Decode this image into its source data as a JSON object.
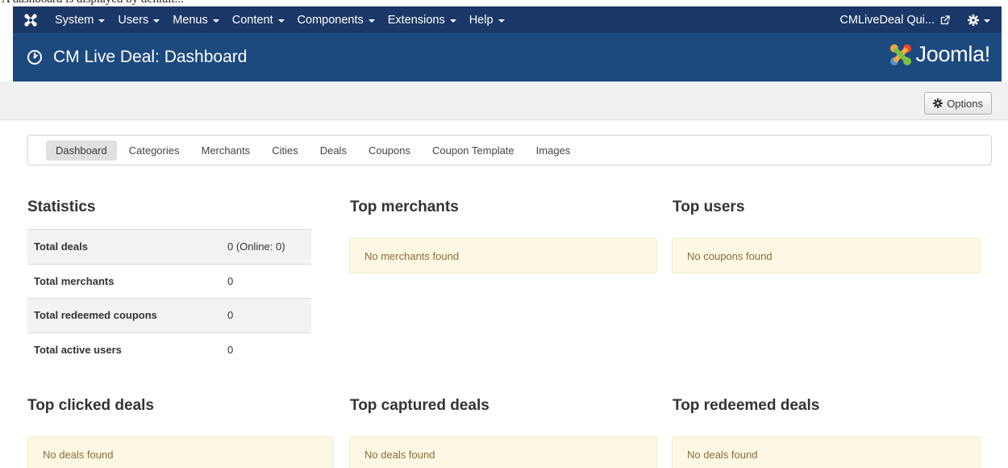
{
  "top_strip_text": "A dashboard is displayed by default...",
  "navbar": {
    "menus": [
      {
        "label": "System"
      },
      {
        "label": "Users"
      },
      {
        "label": "Menus"
      },
      {
        "label": "Content"
      },
      {
        "label": "Components"
      },
      {
        "label": "Extensions"
      },
      {
        "label": "Help"
      }
    ],
    "site_link": "CMLiveDeal Qui..."
  },
  "header": {
    "title": "CM Live Deal: Dashboard",
    "brand": "Joomla!"
  },
  "toolbar": {
    "options_label": "Options"
  },
  "subnav": {
    "items": [
      {
        "label": "Dashboard",
        "active": true
      },
      {
        "label": "Categories"
      },
      {
        "label": "Merchants"
      },
      {
        "label": "Cities"
      },
      {
        "label": "Deals"
      },
      {
        "label": "Coupons"
      },
      {
        "label": "Coupon Template"
      },
      {
        "label": "Images"
      }
    ]
  },
  "statistics": {
    "title": "Statistics",
    "rows": [
      {
        "label": "Total deals",
        "value": "0 (Online: 0)"
      },
      {
        "label": "Total merchants",
        "value": "0"
      },
      {
        "label": "Total redeemed coupons",
        "value": "0"
      },
      {
        "label": "Total active users",
        "value": "0"
      }
    ]
  },
  "top_merchants": {
    "title": "Top merchants",
    "empty": "No merchants found"
  },
  "top_users": {
    "title": "Top users",
    "empty": "No coupons found"
  },
  "top_clicked": {
    "title": "Top clicked deals",
    "empty": "No deals found"
  },
  "top_captured": {
    "title": "Top captured deals",
    "empty": "No deals found"
  },
  "top_redeemed": {
    "title": "Top redeemed deals",
    "empty": "No deals found"
  },
  "colors": {
    "navbar": "#1a3867",
    "header": "#1c4a7f",
    "alert_bg": "#fcf8e3",
    "alert_text": "#8a6d3b"
  }
}
